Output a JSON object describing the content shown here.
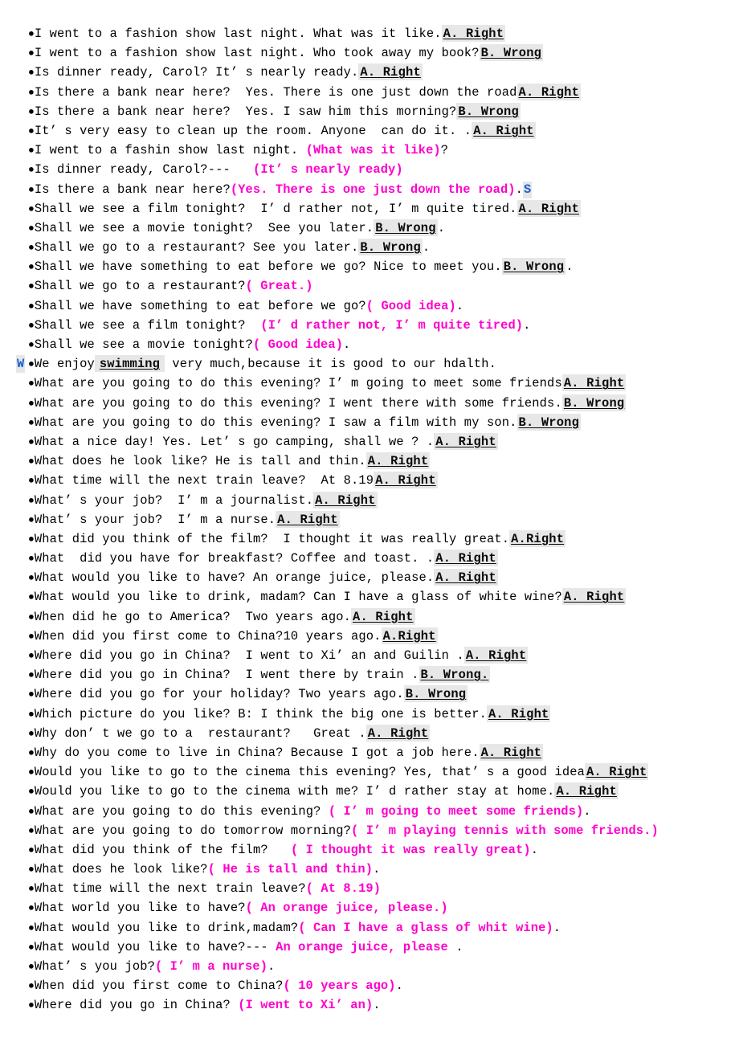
{
  "document": {
    "title": "English Dialogue Practice Sheet",
    "bullet_glyph": "●",
    "colors": {
      "text": "#000000",
      "answer_magenta": "#ff00cc",
      "marker_blue": "#1f5fd0",
      "highlight_gray": "#e7e7e7",
      "page_background": "#ffffff"
    }
  },
  "lines": [
    {
      "marker": null,
      "pre": "I went to a fashion show last night. What was it like.",
      "chip": "A. Right",
      "post": ""
    },
    {
      "marker": null,
      "pre": "I went to a fashion show last night. Who took away my book?",
      "chip": "B. Wrong",
      "post": ""
    },
    {
      "marker": null,
      "pre": "Is dinner ready, Carol? It’ s nearly ready.",
      "chip": "A. Right",
      "post": ""
    },
    {
      "marker": null,
      "pre": "Is there a bank near here?  Yes. There is one just down the road",
      "chip": "A. Right",
      "post": ""
    },
    {
      "marker": null,
      "pre": "Is there a bank near here?  Yes. I saw him this morning?",
      "chip": "B. Wrong",
      "post": ""
    },
    {
      "marker": null,
      "pre": "It’ s very easy to clean up the room. Anyone  can do it. .",
      "chip": "A. Right",
      "post": ""
    },
    {
      "marker": null,
      "pre": "I went to a fashin show last night. ",
      "magenta": "(What was it like)",
      "post": "?"
    },
    {
      "marker": null,
      "pre": "Is dinner ready, Carol?---   ",
      "magenta": "(It’ s nearly ready)",
      "post": ""
    },
    {
      "marker": null,
      "pre": "Is there a bank near here?",
      "magenta": "(Yes. There is one just down the road)",
      "post": ".",
      "tail_marker": "S"
    },
    {
      "marker": null,
      "pre": "Shall we see a film tonight?  I’ d rather not, I’ m quite tired.",
      "chip": "A. Right",
      "post": ""
    },
    {
      "marker": null,
      "pre": "Shall we see a movie tonight?  See you later.",
      "chip": "B. Wrong",
      "post": "."
    },
    {
      "marker": null,
      "pre": "Shall we go to a restaurant? See you later.",
      "chip": "B. Wrong",
      "post": "."
    },
    {
      "marker": null,
      "pre": "Shall we have something to eat before we go? Nice to meet you.",
      "chip": "B. Wrong",
      "post": "."
    },
    {
      "marker": null,
      "pre": "Shall we go to a restaurant?",
      "magenta": "( Great.)",
      "post": ""
    },
    {
      "marker": null,
      "pre": "Shall we have something to eat before we go?",
      "magenta": "( Good idea)",
      "post": "."
    },
    {
      "marker": null,
      "pre": "Shall we see a film tonight?  ",
      "magenta": "(I’ d rather not, I’ m quite tired)",
      "post": "."
    },
    {
      "marker": null,
      "pre": "Shall we see a movie tonight?",
      "magenta": "( Good idea)",
      "post": "."
    },
    {
      "marker": "W",
      "pre": "We enjoy",
      "blank": "swimming",
      "post": " very much,because it is good to our hdalth."
    },
    {
      "marker": null,
      "pre": "What are you going to do this evening? I’ m going to meet some friends",
      "chip": "A. Right",
      "post": ""
    },
    {
      "marker": null,
      "pre": "What are you going to do this evening? I went there with some friends.",
      "chip": "B. Wrong",
      "post": ""
    },
    {
      "marker": null,
      "pre": "What are you going to do this evening? I saw a film with my son.",
      "chip": "B. Wrong",
      "post": ""
    },
    {
      "marker": null,
      "pre": "What a nice day! Yes. Let’ s go camping, shall we ? .",
      "chip": "A. Right",
      "post": ""
    },
    {
      "marker": null,
      "pre": "What does he look like? He is tall and thin.",
      "chip": "A. Right",
      "post": ""
    },
    {
      "marker": null,
      "pre": "What time will the next train leave?  At 8.19",
      "chip": "A. Right",
      "post": ""
    },
    {
      "marker": null,
      "pre": "What’ s your job?  I’ m a journalist.",
      "chip": "A. Right",
      "post": ""
    },
    {
      "marker": null,
      "pre": "What’ s your job?  I’ m a nurse.",
      "chip": "A. Right",
      "post": ""
    },
    {
      "marker": null,
      "pre": "What did you think of the film?  I thought it was really great.",
      "chip": "A.Right",
      "post": ""
    },
    {
      "marker": null,
      "pre": "What  did you have for breakfast? Coffee and toast. .",
      "chip": "A. Right",
      "post": ""
    },
    {
      "marker": null,
      "pre": "What would you like to have? An orange juice, please.",
      "chip": "A. Right",
      "post": ""
    },
    {
      "marker": null,
      "pre": "What would you like to drink, madam? Can I have a glass of white wine?",
      "chip": "A. Right",
      "post": ""
    },
    {
      "marker": null,
      "pre": "When did he go to America?  Two years ago.",
      "chip": "A. Right",
      "post": ""
    },
    {
      "marker": null,
      "pre": "When did you first come to China?10 years ago.",
      "chip": "A.Right",
      "post": ""
    },
    {
      "marker": null,
      "pre": "Where did you go in China?  I went to Xi’ an and Guilin .",
      "chip": "A. Right",
      "post": ""
    },
    {
      "marker": null,
      "pre": "Where did you go in China?  I went there by train .",
      "chip": "B. Wrong.",
      "post": ""
    },
    {
      "marker": null,
      "pre": "Where did you go for your holiday? Two years ago.",
      "chip": "B. Wrong",
      "post": ""
    },
    {
      "marker": null,
      "pre": "Which picture do you like? B: I think the big one is better.",
      "chip": "A. Right",
      "post": ""
    },
    {
      "marker": null,
      "pre": "Why don’ t we go to a  restaurant?   Great .",
      "chip": "A. Right",
      "post": ""
    },
    {
      "marker": null,
      "pre": "Why do you come to live in China? Because I got a job here.",
      "chip": "A. Right",
      "post": ""
    },
    {
      "marker": null,
      "pre": "Would you like to go to the cinema this evening? Yes, that’ s a good idea",
      "chip": "A. Right",
      "post": ""
    },
    {
      "marker": null,
      "pre": "Would you like to go to the cinema with me? I’ d rather stay at home.",
      "chip": "A. Right",
      "post": ""
    },
    {
      "marker": null,
      "pre": "What are you going to do this evening? ",
      "magenta": "( I’ m going to meet some friends)",
      "post": "."
    },
    {
      "marker": null,
      "pre": "What are you going to do tomorrow morning?",
      "magenta": "( I’ m playing tennis with some friends.)",
      "post": ""
    },
    {
      "marker": null,
      "pre": "What did you think of the film?   ",
      "magenta": "( I thought it was really great)",
      "post": "."
    },
    {
      "marker": null,
      "pre": "What does he look like?",
      "magenta": "( He is tall and thin)",
      "post": "."
    },
    {
      "marker": null,
      "pre": "What time will the next train leave?",
      "magenta": "( At 8.19)",
      "post": ""
    },
    {
      "marker": null,
      "pre": "What world you like to have?",
      "magenta": "( An orange juice, please.)",
      "post": ""
    },
    {
      "marker": null,
      "pre": "What would you like to drink,madam?",
      "magenta": "( Can I have a glass of whit wine)",
      "post": "."
    },
    {
      "marker": null,
      "pre": "What would you like to have?--- ",
      "magenta": "An orange juice, please ",
      "post": "."
    },
    {
      "marker": null,
      "pre": "What’ s you job?",
      "magenta": "( I’ m a nurse)",
      "post": "."
    },
    {
      "marker": null,
      "pre": "When did you first come to China?",
      "magenta": "( 10 years ago)",
      "post": "."
    },
    {
      "marker": null,
      "pre": "Where did you go in China? ",
      "magenta": "(I went to Xi’ an)",
      "post": "."
    }
  ]
}
